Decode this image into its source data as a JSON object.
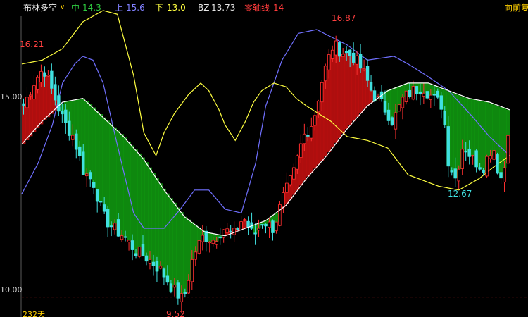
{
  "header": {
    "indicator_name": "布林多空",
    "indicator_color": "#e8e8e8",
    "dropdown_icon": "chevron-down-icon",
    "mid_label": "中",
    "mid_value": "14.3",
    "mid_color": "#2ecc40",
    "up_label": "上",
    "up_value": "15.6",
    "up_color": "#8080ff",
    "down_label": "下",
    "down_value": "13.0",
    "down_color": "#ffff40",
    "bz_label": "BZ",
    "bz_value": "13.73",
    "bz_color": "#e8e8e8",
    "zero_label": "零轴线",
    "zero_value": "14",
    "zero_color": "#ff3b3b",
    "right_label": "向前复"
  },
  "axis": {
    "level_high": "15.00",
    "level_low": "10.00",
    "bottom_text": "232天"
  },
  "annotations": {
    "max_left": "16.21",
    "max_mid": "16.87",
    "min_right": "12.67",
    "min_bottom": "9.52"
  },
  "colors": {
    "background": "#000000",
    "candle_up": "#ff3030",
    "candle_down": "#40e0e0",
    "fill_bull": "#cc1010",
    "fill_bear": "#10a010",
    "upper_band": "#7070ff",
    "lower_band": "#ffff40",
    "mid_line": "#ffffff",
    "ref_line": "#c02020"
  },
  "chart_data": {
    "type": "line",
    "ylim": [
      9.55,
      17.35
    ],
    "reference_lines": [
      15.0,
      10.0
    ],
    "n_candles": 139,
    "upper_band": [
      [
        0,
        12.7
      ],
      [
        8,
        13.5
      ],
      [
        15,
        14.5
      ],
      [
        20,
        15.6
      ],
      [
        26,
        16.1
      ],
      [
        30,
        16.3
      ],
      [
        35,
        16.2
      ],
      [
        40,
        15.6
      ],
      [
        46,
        14.2
      ],
      [
        50,
        13.3
      ],
      [
        55,
        12.2
      ],
      [
        60,
        11.8
      ],
      [
        70,
        11.8
      ],
      [
        78,
        12.3
      ],
      [
        85,
        12.8
      ],
      [
        92,
        12.8
      ],
      [
        100,
        12.3
      ],
      [
        108,
        12.2
      ],
      [
        115,
        13.5
      ],
      [
        120,
        15.0
      ],
      [
        128,
        16.2
      ],
      [
        136,
        16.9
      ],
      [
        145,
        17.0
      ],
      [
        160,
        16.6
      ],
      [
        170,
        16.2
      ],
      [
        183,
        16.3
      ],
      [
        190,
        16.1
      ],
      [
        199,
        15.8
      ],
      [
        210,
        15.4
      ],
      [
        222,
        14.7
      ],
      [
        230,
        14.2
      ],
      [
        240,
        13.7
      ]
    ],
    "lower_band": [
      [
        0,
        16.1
      ],
      [
        10,
        16.2
      ],
      [
        20,
        16.5
      ],
      [
        30,
        17.2
      ],
      [
        40,
        17.5
      ],
      [
        47,
        17.4
      ],
      [
        55,
        15.8
      ],
      [
        60,
        14.3
      ],
      [
        66,
        13.7
      ],
      [
        70,
        14.3
      ],
      [
        75,
        14.8
      ],
      [
        82,
        15.3
      ],
      [
        88,
        15.6
      ],
      [
        92,
        15.4
      ],
      [
        97,
        14.9
      ],
      [
        100,
        14.5
      ],
      [
        105,
        14.1
      ],
      [
        110,
        14.6
      ],
      [
        114,
        15.1
      ],
      [
        118,
        15.4
      ],
      [
        124,
        15.6
      ],
      [
        130,
        15.5
      ],
      [
        135,
        15.2
      ],
      [
        140,
        15.0
      ],
      [
        146,
        14.8
      ],
      [
        152,
        14.6
      ],
      [
        160,
        14.2
      ],
      [
        170,
        14.1
      ],
      [
        180,
        13.9
      ],
      [
        190,
        13.2
      ],
      [
        200,
        13.0
      ],
      [
        205,
        12.9
      ],
      [
        215,
        12.8
      ],
      [
        225,
        13.1
      ],
      [
        232,
        13.4
      ],
      [
        240,
        13.7
      ]
    ],
    "mid_line": [
      [
        0,
        14.0
      ],
      [
        10,
        14.6
      ],
      [
        20,
        15.1
      ],
      [
        30,
        15.2
      ],
      [
        40,
        14.7
      ],
      [
        50,
        14.2
      ],
      [
        60,
        13.6
      ],
      [
        70,
        12.8
      ],
      [
        80,
        12.1
      ],
      [
        90,
        11.7
      ],
      [
        100,
        11.6
      ],
      [
        110,
        11.8
      ],
      [
        120,
        12.0
      ],
      [
        130,
        12.4
      ],
      [
        140,
        13.1
      ],
      [
        150,
        13.7
      ],
      [
        160,
        14.4
      ],
      [
        170,
        15.0
      ],
      [
        180,
        15.4
      ],
      [
        190,
        15.6
      ],
      [
        200,
        15.6
      ],
      [
        210,
        15.4
      ],
      [
        220,
        15.2
      ],
      [
        230,
        15.1
      ],
      [
        240,
        14.9
      ]
    ],
    "price_path": [
      [
        0,
        15.0
      ],
      [
        4,
        15.6
      ],
      [
        8,
        16.0
      ],
      [
        12,
        15.3
      ],
      [
        16,
        14.6
      ],
      [
        20,
        14.2
      ],
      [
        24,
        13.3
      ],
      [
        28,
        13.0
      ],
      [
        32,
        12.1
      ],
      [
        36,
        11.8
      ],
      [
        40,
        11.6
      ],
      [
        45,
        11.2
      ],
      [
        50,
        11.0
      ],
      [
        55,
        10.7
      ],
      [
        60,
        10.2
      ],
      [
        64,
        9.9
      ],
      [
        68,
        11.1
      ],
      [
        72,
        11.6
      ],
      [
        76,
        11.5
      ],
      [
        80,
        11.8
      ],
      [
        84,
        11.6
      ],
      [
        88,
        12.1
      ],
      [
        92,
        11.6
      ],
      [
        96,
        12.0
      ],
      [
        100,
        11.8
      ],
      [
        104,
        12.6
      ],
      [
        108,
        13.2
      ],
      [
        112,
        14.2
      ],
      [
        116,
        14.6
      ],
      [
        120,
        15.8
      ],
      [
        124,
        16.6
      ],
      [
        128,
        16.4
      ],
      [
        132,
        16.3
      ],
      [
        136,
        15.9
      ],
      [
        140,
        15.3
      ],
      [
        144,
        15.0
      ],
      [
        148,
        14.6
      ],
      [
        152,
        15.2
      ],
      [
        156,
        15.4
      ],
      [
        160,
        15.5
      ],
      [
        164,
        15.2
      ],
      [
        168,
        15.0
      ],
      [
        170,
        13.6
      ],
      [
        173,
        13.1
      ],
      [
        176,
        14.0
      ],
      [
        180,
        13.6
      ],
      [
        184,
        13.4
      ],
      [
        188,
        14.0
      ],
      [
        190,
        13.3
      ],
      [
        192,
        13.0
      ],
      [
        194,
        14.4
      ]
    ]
  }
}
